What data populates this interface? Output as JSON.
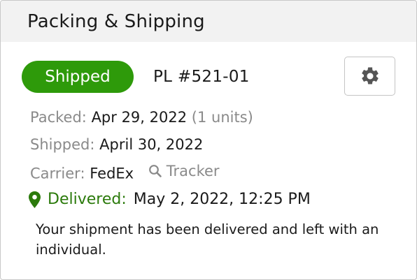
{
  "panel": {
    "title": "Packing & Shipping"
  },
  "status": {
    "label": "Shipped",
    "color": "#2e9a0a"
  },
  "packing_list": {
    "number": "PL #521-01"
  },
  "settings_button": {
    "icon": "gear-icon"
  },
  "details": {
    "packed_label": "Packed:",
    "packed_date": "Apr 29, 2022",
    "packed_units": "(1 units)",
    "shipped_label": "Shipped:",
    "shipped_date": "April 30, 2022",
    "carrier_label": "Carrier:",
    "carrier_value": "FedEx",
    "tracker_label": "Tracker",
    "tracker_icon": "search-icon"
  },
  "delivery": {
    "icon": "map-pin-icon",
    "label": "Delivered:",
    "datetime": "May 2, 2022, 12:25 PM",
    "note": "Your shipment has been delivered and left with an individual.",
    "color": "#2b7a0b"
  }
}
